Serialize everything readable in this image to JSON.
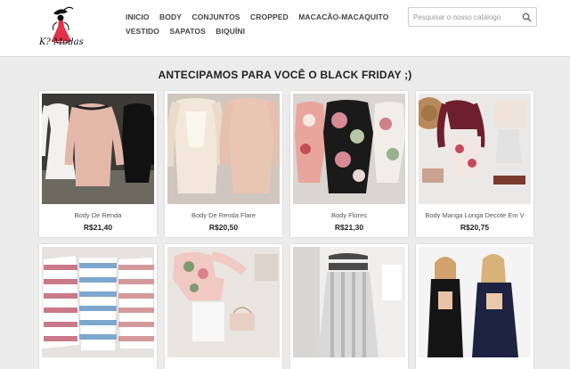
{
  "header": {
    "logo_text": "K? Modas",
    "nav_row1": [
      "INICIO",
      "BODY",
      "CONJUNTOS",
      "CROPPED",
      "MACACÃO-MACAQUITO"
    ],
    "nav_row2": [
      "VESTIDO",
      "SAPATOS",
      "BIQUÍNI"
    ],
    "search_placeholder": "Pesquisar o nosso catálogo"
  },
  "main": {
    "title": "ANTECIPAMOS PARA VOCÊ O BLACK FRIDAY ;)"
  },
  "products": [
    {
      "name": "Body De Renda",
      "price": "R$21,40"
    },
    {
      "name": "Body De Renda Flare",
      "price": "R$20,50"
    },
    {
      "name": "Body Flores",
      "price": "R$21,30"
    },
    {
      "name": "Body Manga Longa Decote Em V",
      "price": "R$20,75"
    },
    {
      "name": "",
      "price": ""
    },
    {
      "name": "",
      "price": ""
    },
    {
      "name": "",
      "price": ""
    },
    {
      "name": "",
      "price": ""
    }
  ],
  "colors": {
    "logo_accent": "#e0334b",
    "header_bg": "#ffffff",
    "page_bg": "#ececec"
  }
}
